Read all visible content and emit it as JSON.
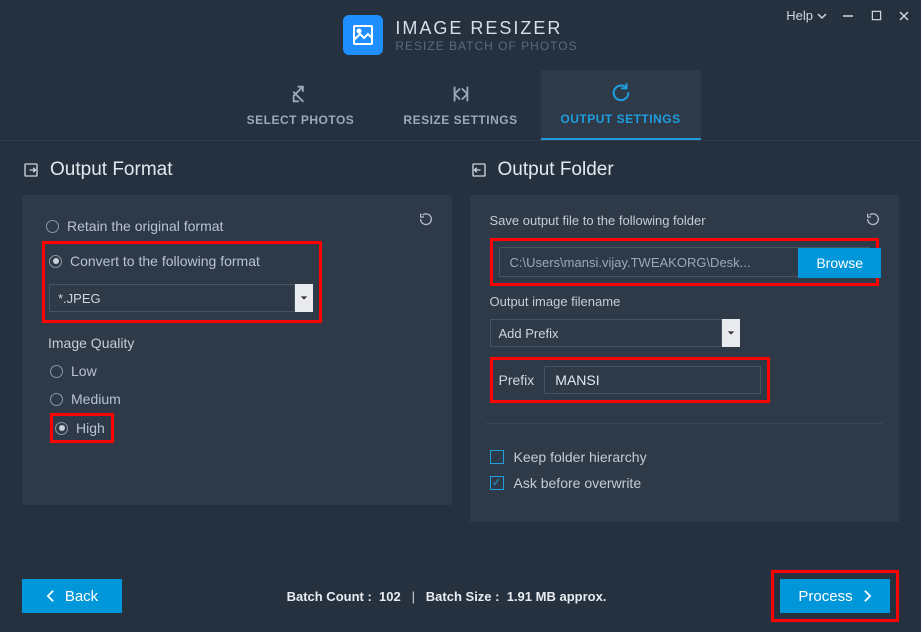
{
  "titlebar": {
    "help": "Help",
    "brand_title": "IMAGE RESIZER",
    "brand_sub": "RESIZE BATCH OF PHOTOS"
  },
  "tabs": {
    "select": "SELECT PHOTOS",
    "resize": "RESIZE SETTINGS",
    "output": "OUTPUT SETTINGS"
  },
  "output_format": {
    "title": "Output Format",
    "retain": "Retain the original format",
    "convert": "Convert to the following format",
    "format_value": "*.JPEG",
    "quality_label": "Image Quality",
    "low": "Low",
    "medium": "Medium",
    "high": "High"
  },
  "output_folder": {
    "title": "Output Folder",
    "save_label": "Save output file to the following folder",
    "path": "C:\\Users\\mansi.vijay.TWEAKORG\\Desk...",
    "browse": "Browse",
    "filename_label": "Output image filename",
    "prefix_mode": "Add Prefix",
    "prefix_lbl": "Prefix",
    "prefix_val": "MANSI",
    "keep_hierarchy": "Keep folder hierarchy",
    "ask_overwrite": "Ask before overwrite"
  },
  "footer": {
    "back": "Back",
    "batch_count_lbl": "Batch Count :",
    "batch_count": "102",
    "batch_size_lbl": "Batch Size :",
    "batch_size": "1.91 MB approx.",
    "process": "Process"
  }
}
